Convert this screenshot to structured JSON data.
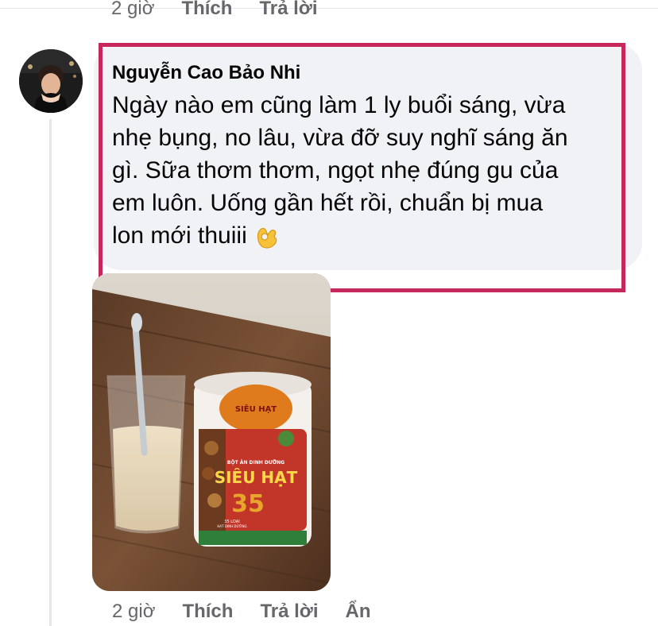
{
  "previous_comment": {
    "time": "2 giờ",
    "like_label": "Thích",
    "reply_label": "Trả lời"
  },
  "comment": {
    "author": "Nguyễn Cao Bảo Nhi",
    "text": "Ngày nào em cũng làm 1 ly buổi sáng, vừa\nnhẹ bụng, no lâu, vừa đỡ suy nghĩ sáng ăn\ngì. Sữa thơm thơm, ngọt nhẹ đúng gu của\nem luôn. Uống gần hết rồi, chuẩn bị mua\nlon mới thuiii",
    "emoji": "ok-hand-icon",
    "highlight_color": "#c6285c",
    "photo": {
      "can_label_top": "SIÊU HẠT",
      "can_label_main": "SIÊU HẠT",
      "can_sub": "BỘT ĂN DINH DƯỠNG",
      "can_number": "35",
      "can_small_1": "35 LOẠI",
      "can_small_2": "HẠT DINH DƯỠNG"
    }
  },
  "actions": {
    "time": "2 giờ",
    "like_label": "Thích",
    "reply_label": "Trả lời",
    "hide_label": "Ẩn"
  }
}
